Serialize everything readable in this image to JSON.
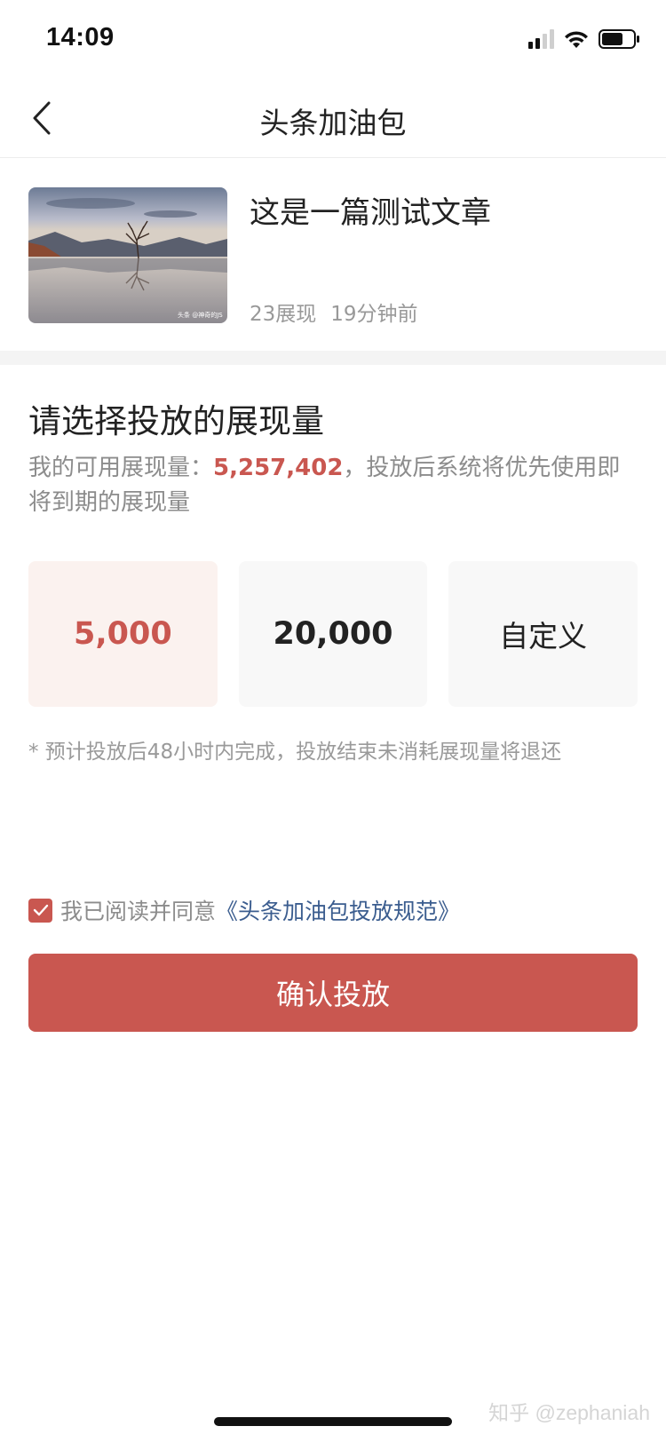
{
  "status_bar": {
    "time": "14:09"
  },
  "nav": {
    "title": "头条加油包"
  },
  "article": {
    "title": "这是一篇测试文章",
    "views": "23展现",
    "time_ago": "19分钟前",
    "thumb_caption": "头条 @神奇的JS"
  },
  "section": {
    "title": "请选择投放的展现量",
    "desc_prefix": "我的可用展现量：",
    "available": "5,257,402",
    "desc_suffix": "，投放后系统将优先使用即将到期的展现量"
  },
  "options": [
    {
      "label": "5,000",
      "selected": true
    },
    {
      "label": "20,000",
      "selected": false
    },
    {
      "label": "自定义",
      "selected": false
    }
  ],
  "note": "* 预计投放后48小时内完成，投放结束未消耗展现量将退还",
  "agreement": {
    "checked": true,
    "text": "我已阅读并同意",
    "link": "《头条加油包投放规范》"
  },
  "confirm_button": "确认投放",
  "watermark": "知乎 @zephaniah",
  "colors": {
    "accent": "#c95750",
    "link": "#3b5d8f",
    "selected_bg": "#fbf2ef"
  },
  "icons": [
    "signal-icon",
    "wifi-icon",
    "battery-icon",
    "back-arrow-icon",
    "checkmark-icon"
  ]
}
